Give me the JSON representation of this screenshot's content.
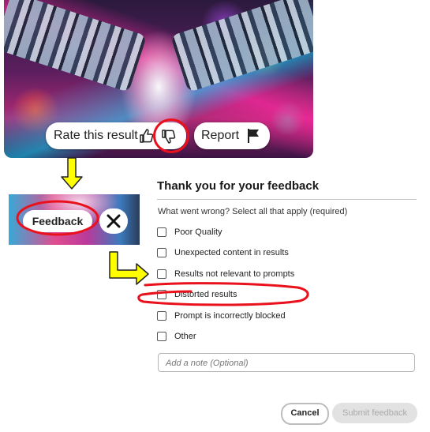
{
  "rate_bar": {
    "rate_label": "Rate this result",
    "thumbs_up_icon": "thumbs-up-icon",
    "thumbs_down_icon": "thumbs-down-icon",
    "report_label": "Report",
    "flag_icon": "flag-icon"
  },
  "feedback_strip": {
    "feedback_label": "Feedback",
    "close_icon": "close-icon"
  },
  "dialog": {
    "title": "Thank you for your feedback",
    "question": "What went wrong? Select all that apply (required)",
    "options": [
      {
        "label": "Poor Quality",
        "checked": false
      },
      {
        "label": "Unexpected content in results",
        "checked": false
      },
      {
        "label": "Results not relevant to prompts",
        "checked": false
      },
      {
        "label": "Distorted results",
        "checked": false
      },
      {
        "label": "Prompt is incorrectly blocked",
        "checked": false
      },
      {
        "label": "Other",
        "checked": false
      }
    ],
    "note_placeholder": "Add a note (Optional)",
    "cancel_label": "Cancel",
    "submit_label": "Submit feedback"
  },
  "colors": {
    "annotation_red": "#e8111c",
    "arrow_yellow": "#ffff00",
    "submit_disabled_bg": "#e2e2e2"
  }
}
